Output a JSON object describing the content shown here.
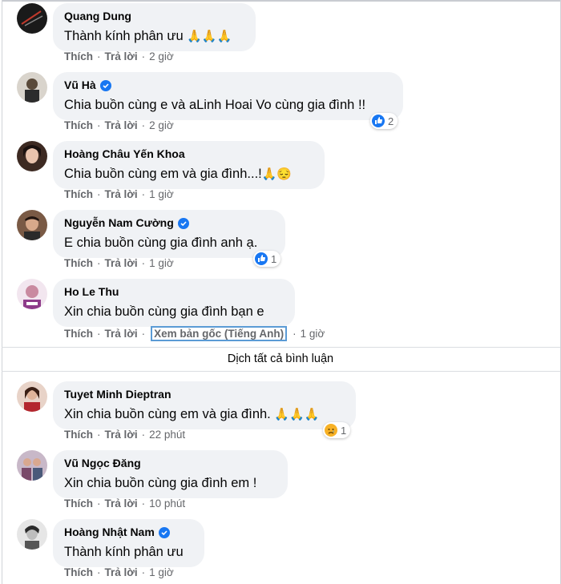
{
  "actions": {
    "like": "Thích",
    "reply": "Trả lời",
    "separator": "·"
  },
  "comments": [
    {
      "author": "Quang Dung",
      "verified": false,
      "text": "Thành kính phân ưu",
      "emoji": "🙏🙏🙏",
      "time": "2 giờ",
      "reaction": null
    },
    {
      "author": "Vũ Hà",
      "verified": true,
      "text": "Chia buồn cùng e và aLinh Hoai Vo cùng gia đình !!",
      "emoji": "",
      "time": "2 giờ",
      "reaction": {
        "icon": "like-icon",
        "count": "2"
      }
    },
    {
      "author": "Hoàng Châu Yến Khoa",
      "verified": false,
      "text": "Chia buồn cùng em và gia đình...!",
      "emoji": "🙏😔",
      "time": "1 giờ",
      "reaction": null
    },
    {
      "author": "Nguyễn Nam Cường",
      "verified": true,
      "text": "E chia buồn cùng gia đình anh ạ.",
      "emoji": "",
      "time": "1 giờ",
      "reaction": {
        "icon": "like-icon",
        "count": "1"
      }
    },
    {
      "author": "Ho Le Thu",
      "verified": false,
      "text": "Xin chia buồn cùng gia đình bạn e",
      "emoji": "",
      "time": "1 giờ",
      "reaction": null,
      "translate_link": "Xem bản gốc (Tiếng Anh)"
    },
    {
      "author": "Tuyet Minh Dieptran",
      "verified": false,
      "text": "Xin chia buồn cùng em và gia đình.",
      "emoji": "🙏🙏🙏",
      "time": "22 phút",
      "reaction": {
        "icon": "sad-icon",
        "count": "1"
      }
    },
    {
      "author": "Vũ Ngọc Đăng",
      "verified": false,
      "text": "Xin chia buồn cùng gia đình em !",
      "emoji": "",
      "time": "10 phút",
      "reaction": null
    },
    {
      "author": "Hoàng Nhật Nam",
      "verified": true,
      "text": "Thành kính phân ưu",
      "emoji": "",
      "time": "1 giờ",
      "reaction": null
    }
  ],
  "translate_all": "Dịch tất cả bình luận",
  "colors": {
    "bubble": "#f0f2f5",
    "meta": "#65676b",
    "verified": "#1877f2",
    "like": "#1877f2",
    "sad": "#f7b125"
  }
}
